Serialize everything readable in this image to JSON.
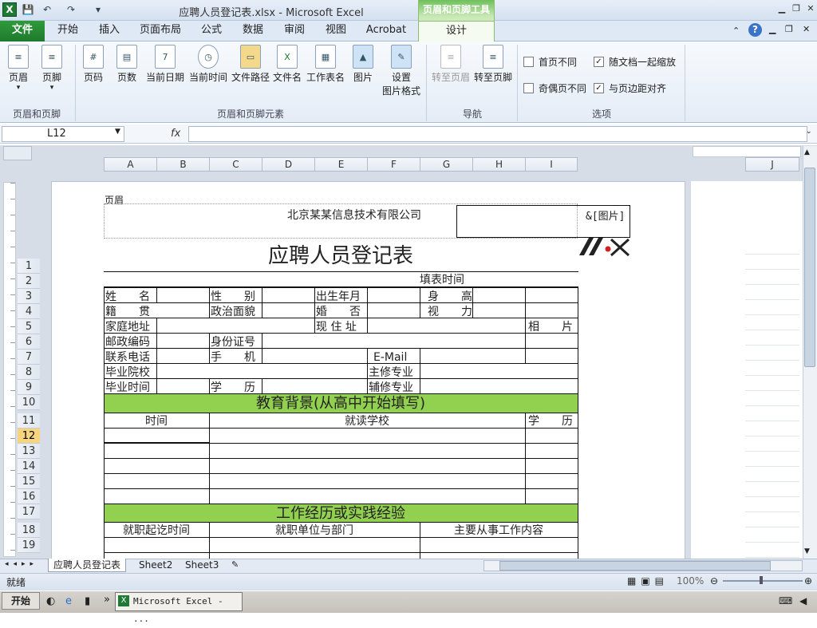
{
  "window": {
    "title": "应聘人员登记表.xlsx  -  Microsoft Excel",
    "context_group": "页眉和页脚工具"
  },
  "tabs": [
    "文件",
    "开始",
    "插入",
    "页面布局",
    "公式",
    "数据",
    "审阅",
    "视图",
    "Acrobat",
    "设计"
  ],
  "ribbon": {
    "hf": [
      "页眉",
      "页脚"
    ],
    "elements": [
      "页码",
      "页数",
      "当前日期",
      "当前时间",
      "文件路径",
      "文件名",
      "工作表名",
      "图片",
      "设置图片格式"
    ],
    "elements_format_line1": "设置",
    "elements_format_line2": "图片格式",
    "nav": [
      "转至页眉",
      "转至页脚"
    ],
    "options": {
      "first_page": "首页不同",
      "odd_even": "奇偶页不同",
      "scale_doc": "随文档一起缩放",
      "align_margins": "与页边距对齐"
    },
    "groups": {
      "hf": "页眉和页脚",
      "elements": "页眉和页脚元素",
      "nav": "导航",
      "options": "选项"
    }
  },
  "namebox": "L12",
  "fx": "fx",
  "columns": [
    "A",
    "B",
    "C",
    "D",
    "E",
    "F",
    "G",
    "H",
    "I"
  ],
  "col_j": "J",
  "rows": [
    "1",
    "2",
    "3",
    "4",
    "5",
    "6",
    "7",
    "8",
    "9",
    "10",
    "11",
    "12",
    "13",
    "14",
    "15",
    "16",
    "17",
    "18",
    "19"
  ],
  "header": {
    "label": "页眉",
    "company": "北京某某信息技术有限公司",
    "picture": "&[图片]"
  },
  "form": {
    "title": "应聘人员登记表",
    "fill_time": "填表时间",
    "name": "姓　　名",
    "gender": "性　　别",
    "birth": "出生年月",
    "height": "身　　高",
    "native": "籍　　贯",
    "political": "政治面貌",
    "marriage": "婚　　否",
    "vision": "视　　力",
    "address": "家庭地址",
    "current_address": "现 住 址",
    "photo": "相　　片",
    "postcode": "邮政编码",
    "id": "身份证号",
    "phone": "联系电话",
    "mobile": "手　　机",
    "email": "E-Mail",
    "school": "毕业院校",
    "major": "主修专业",
    "grad_time": "毕业时间",
    "degree": "学　　历",
    "minor": "辅修专业",
    "edu_title": "教育背景(从高中开始填写)",
    "edu_time": "时间",
    "edu_school": "就读学校",
    "edu_degree": "学　　历",
    "work_title": "工作经历或实践经验",
    "work_time": "就职起讫时间",
    "work_unit": "就职单位与部门",
    "work_content": "主要从事工作内容"
  },
  "sheets": [
    "应聘人员登记表",
    "Sheet2",
    "Sheet3"
  ],
  "status": {
    "ready": "就绪",
    "zoom": "100%"
  },
  "taskbar": {
    "start": "开始",
    "item": "Microsoft Excel - ..."
  }
}
